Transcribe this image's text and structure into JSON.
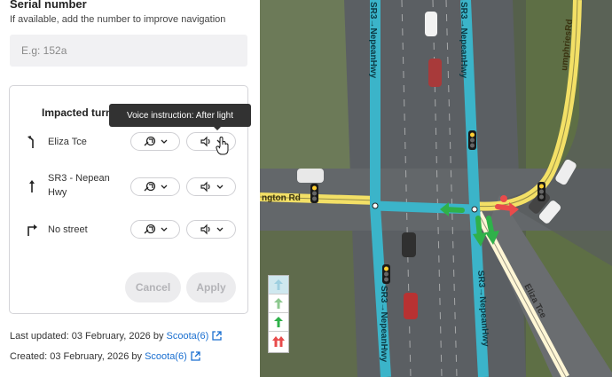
{
  "serial": {
    "title": "Serial number",
    "help": "If available, add the number to improve navigation",
    "placeholder": "E.g: 152a",
    "value": ""
  },
  "turns_card": {
    "title": "Impacted turns",
    "rows": [
      {
        "icon": "turn-slight-left-icon",
        "name": "Eliza Tce"
      },
      {
        "icon": "straight-arrow-icon",
        "name": "SR3 - Nepean Hwy"
      },
      {
        "icon": "turn-right-icon",
        "name": "No street"
      }
    ],
    "cancel_label": "Cancel",
    "apply_label": "Apply"
  },
  "tooltip": "Voice instruction: After light",
  "meta": {
    "updated_prefix": "Last updated: 03 February, 2026 by",
    "updated_user": "Scoota(6)",
    "created_prefix": "Created: 03 February, 2026 by",
    "created_user": "Scoota(6)"
  },
  "map": {
    "labels": {
      "nepean_north_a": "SR3→NepeanHwy",
      "nepean_north_b": "SR3→NepeanHwy",
      "nepean_south_a": "SR3→NepeanHwy",
      "nepean_south_b": "SR3→NepeanHwy",
      "humphries": "umphriesRd",
      "wellington": "ngton Rd",
      "eliza": "Eliza Tce"
    },
    "colors": {
      "nepean": "#3bb4c9",
      "yellow_road": "#f3e066",
      "eliza_road": "#fff6d5",
      "green_arrow": "#2fb14a",
      "red_arrow": "#e84b4b"
    }
  }
}
